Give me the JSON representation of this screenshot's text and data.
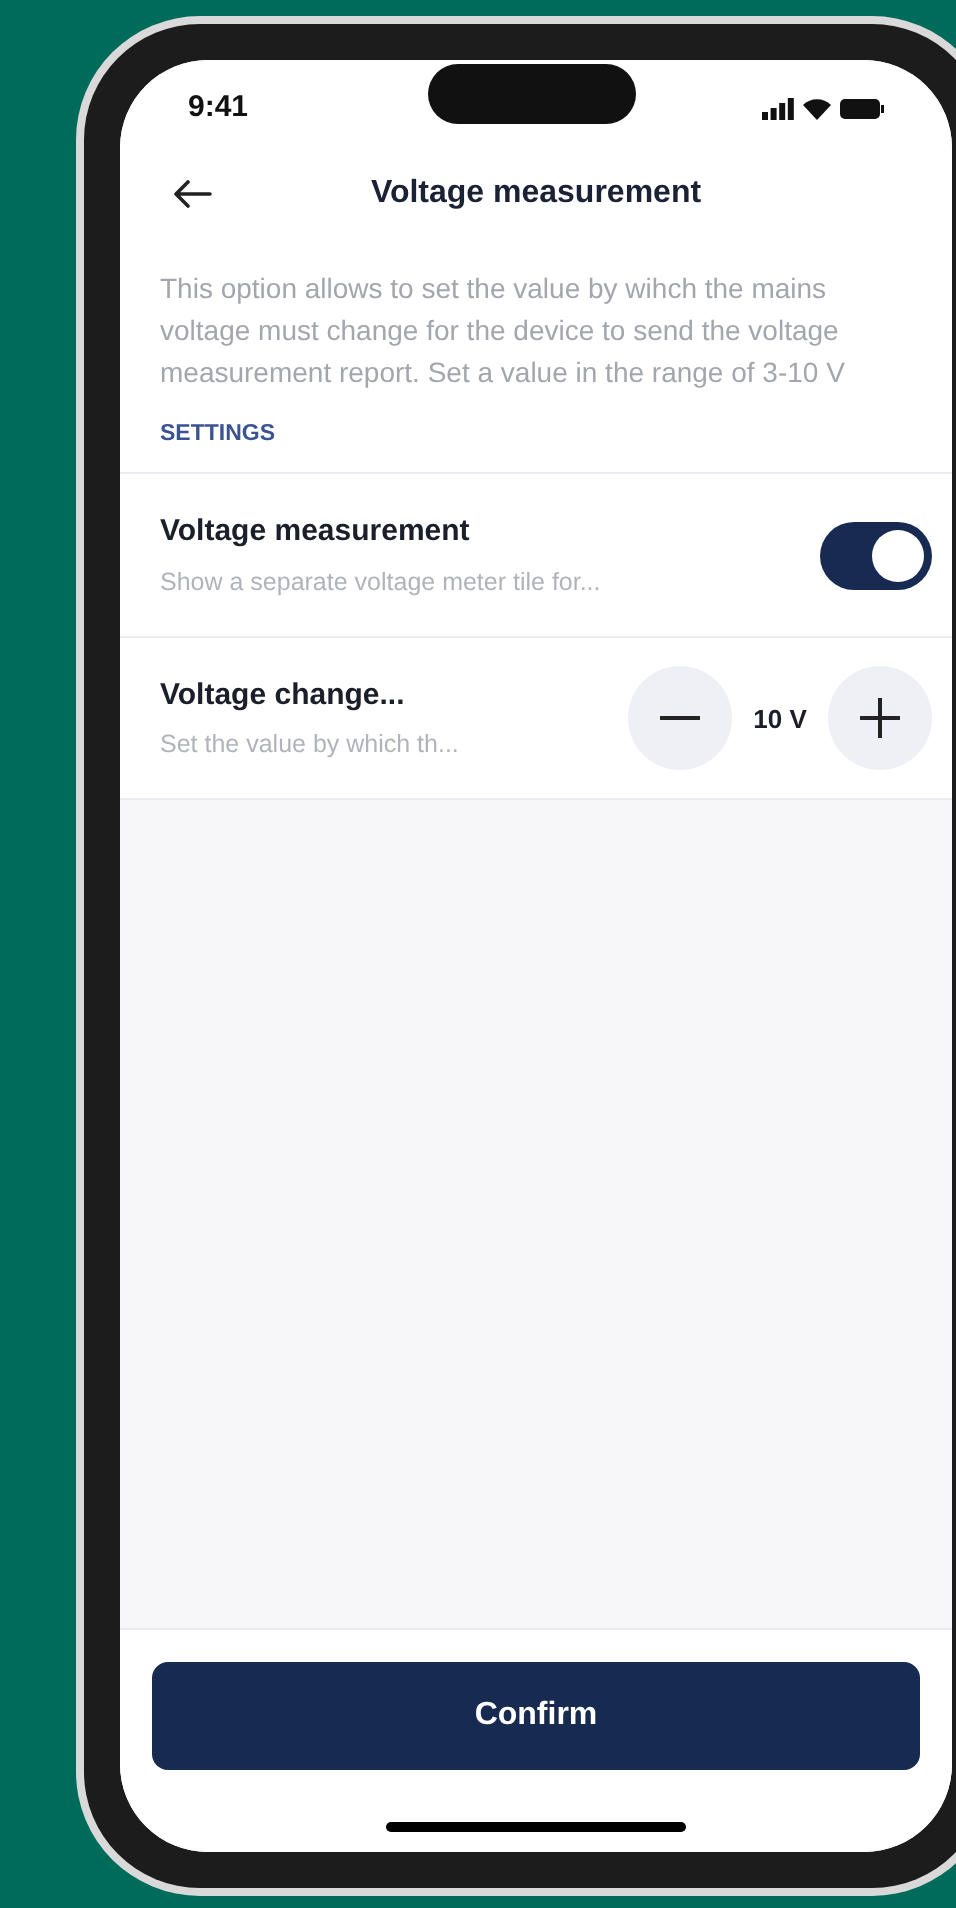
{
  "status_bar": {
    "time": "9:41"
  },
  "header": {
    "title": "Voltage measurement"
  },
  "description": "This option allows to set the value by wihch the mains voltage must change for the device to send the voltage measurement report. Set a value in the range of 3-10 V",
  "section_label": "SETTINGS",
  "settings": [
    {
      "kind": "toggle",
      "title": "Voltage measurement",
      "subtitle": "Show a separate voltage meter tile for...",
      "on": true
    },
    {
      "kind": "stepper",
      "title": "Voltage change...",
      "subtitle": "Set the value by which th...",
      "value": "10 V"
    }
  ],
  "confirm_button": "Confirm"
}
